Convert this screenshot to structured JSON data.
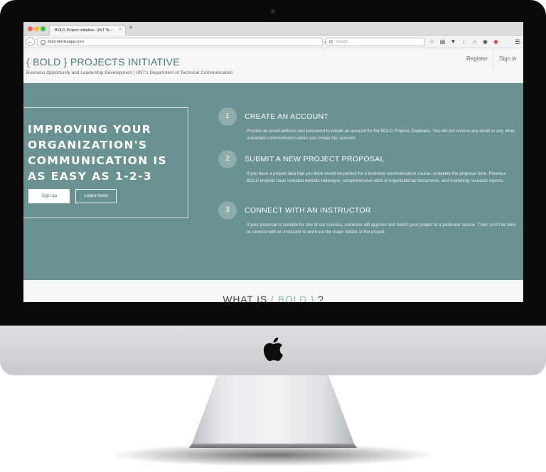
{
  "browser": {
    "tab_title": "BOLD Project Initiative- UNT Te...",
    "tab_close": "×",
    "new_tab": "+",
    "url": "bold.herokuapp.com",
    "search_placeholder": "Search",
    "toolbar_icons": [
      "star-icon",
      "reading-list-icon",
      "pocket-icon",
      "download-icon",
      "home-icon",
      "chat-icon",
      "extension-icon",
      "menu-icon"
    ]
  },
  "header": {
    "title": "{ BOLD } PROJECTS INITIATIVE",
    "subtitle": "Business Opportunity and Leadership Development | UNT's Department of Technical Communication",
    "nav": {
      "register": "Register",
      "signin": "Sign in"
    }
  },
  "hero": {
    "heading": "IMPROVING YOUR ORGANIZATION'S COMMUNICATION IS AS EASY AS 1-2-3",
    "signup_label": "Sign up",
    "learn_more_label": "Learn more",
    "steps": [
      {
        "number": "1",
        "title": "CREATE AN ACCOUNT",
        "description": "Provide an email address and password to create an account for the BOLD Projects Database. You will not receive any email or any other unwanted communication when you create this account."
      },
      {
        "number": "2",
        "title": "SUBMIT A NEW PROJECT PROPOSAL",
        "description": "If you have a project idea that you think would be perfect for a technical communication course, complete the proposal form. Previous BOLD projects have included website redesigns, comprehensive edits of organizational documents, and marketing research reports."
      },
      {
        "number": "3",
        "title": "CONNECT WITH AN INSTRUCTOR",
        "description": "If your proposal is suitable for one of our courses, someone will approve and match your project to a particular course. Then, you'll be able to connect with an instructor to work out the major details of the project."
      }
    ]
  },
  "lower": {
    "heading_prefix": "WHAT IS",
    "heading_accent": "{ BOLD }",
    "heading_suffix": "?"
  },
  "colors": {
    "hero_bg": "#6a9291",
    "title_color": "#4f7877",
    "bezel": "#0a0a0a",
    "chin": "#d6d7d9"
  }
}
